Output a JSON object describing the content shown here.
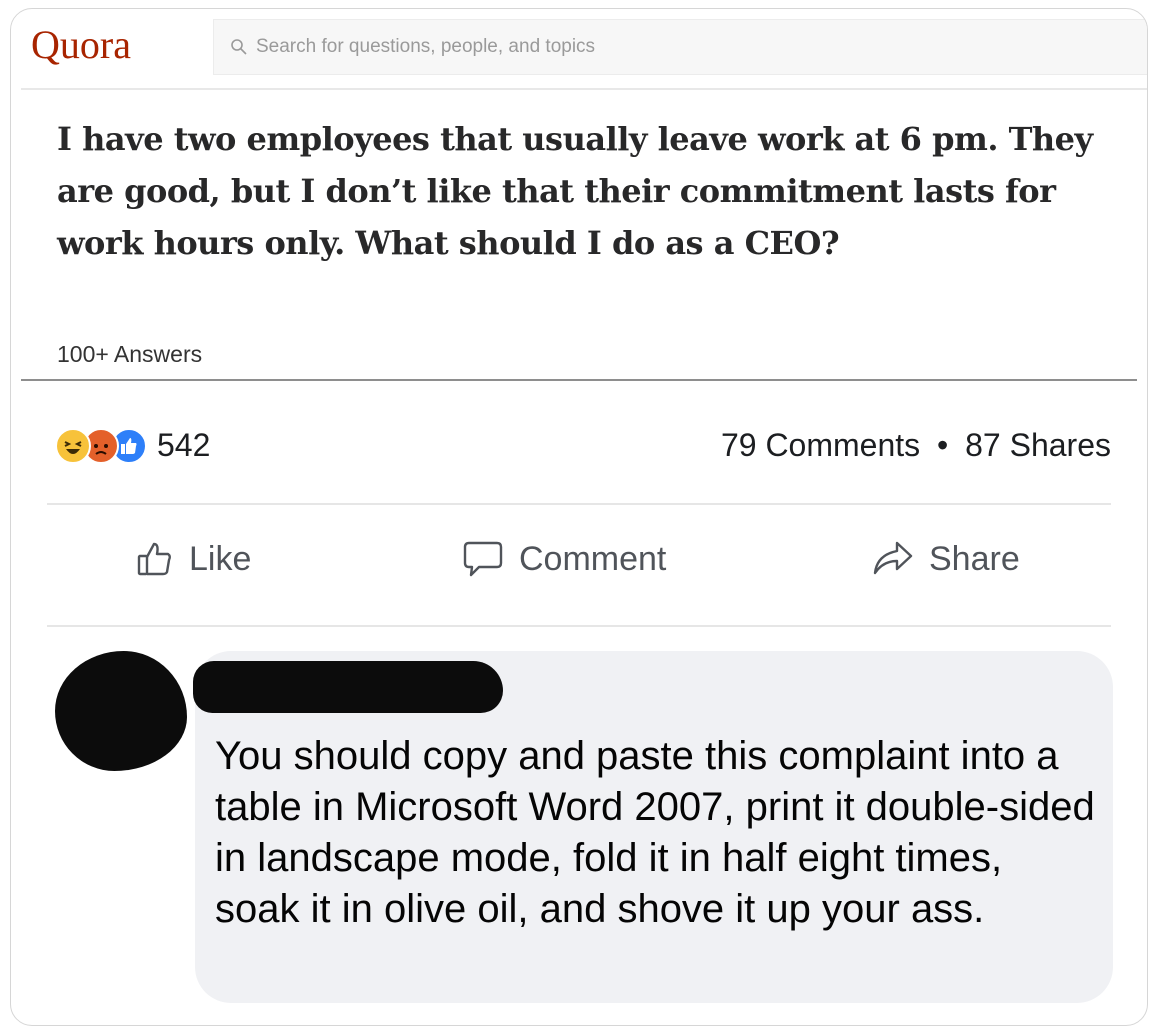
{
  "header": {
    "logo": "Quora",
    "search_placeholder": "Search for questions, people, and topics"
  },
  "question": {
    "title": "I have two employees that usually leave work at 6 pm. They are good, but I don’t like that their commitment lasts for work hours only. What should I do as a CEO?",
    "answers_count": "100+ Answers"
  },
  "post": {
    "reaction_icons": [
      "haha-icon",
      "angry-icon",
      "like-icon"
    ],
    "reaction_count": "542",
    "comments": "79 Comments",
    "separator": "•",
    "shares": "87 Shares",
    "actions": {
      "like": "Like",
      "comment": "Comment",
      "share": "Share"
    }
  },
  "comment": {
    "text": "You should copy and paste this complaint into a table in Microsoft Word 2007, print it double-sided in landscape mode, fold it in half eight times, soak it in olive oil, and shove it up your ass."
  },
  "colors": {
    "quora_brand": "#a82400",
    "facebook_blue": "#2d7ff9",
    "comment_bubble": "#f0f1f4"
  }
}
